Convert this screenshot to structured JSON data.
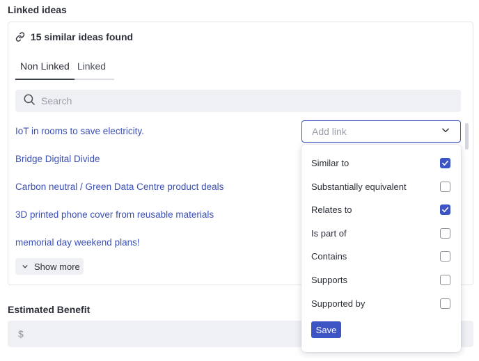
{
  "linked_ideas": {
    "title": "Linked ideas",
    "found_text": "15 similar ideas found",
    "tabs": [
      {
        "label": "Non Linked",
        "active": true
      },
      {
        "label": "Linked",
        "active": false
      }
    ],
    "search": {
      "placeholder": "Search",
      "value": ""
    },
    "ideas": [
      {
        "title": "IoT in rooms to save electricity."
      },
      {
        "title": "Bridge Digital Divide"
      },
      {
        "title": "Carbon neutral / Green Data Centre product deals"
      },
      {
        "title": "3D printed phone cover from reusable materials"
      },
      {
        "title": "memorial day weekend plans!"
      }
    ],
    "show_more_label": "Show more"
  },
  "add_link": {
    "placeholder": "Add link",
    "options": [
      {
        "label": "Similar to",
        "checked": true
      },
      {
        "label": "Substantially equivalent",
        "checked": false
      },
      {
        "label": "Relates to",
        "checked": true
      },
      {
        "label": "Is part of",
        "checked": false
      },
      {
        "label": "Contains",
        "checked": false
      },
      {
        "label": "Supports",
        "checked": false
      },
      {
        "label": "Supported by",
        "checked": false
      }
    ],
    "save_label": "Save"
  },
  "estimated_benefit": {
    "label": "Estimated Benefit",
    "currency": "$",
    "value": ""
  },
  "colors": {
    "accent": "#3d55c4",
    "link": "#3a4fb8",
    "input_bg": "#eef0f3"
  }
}
